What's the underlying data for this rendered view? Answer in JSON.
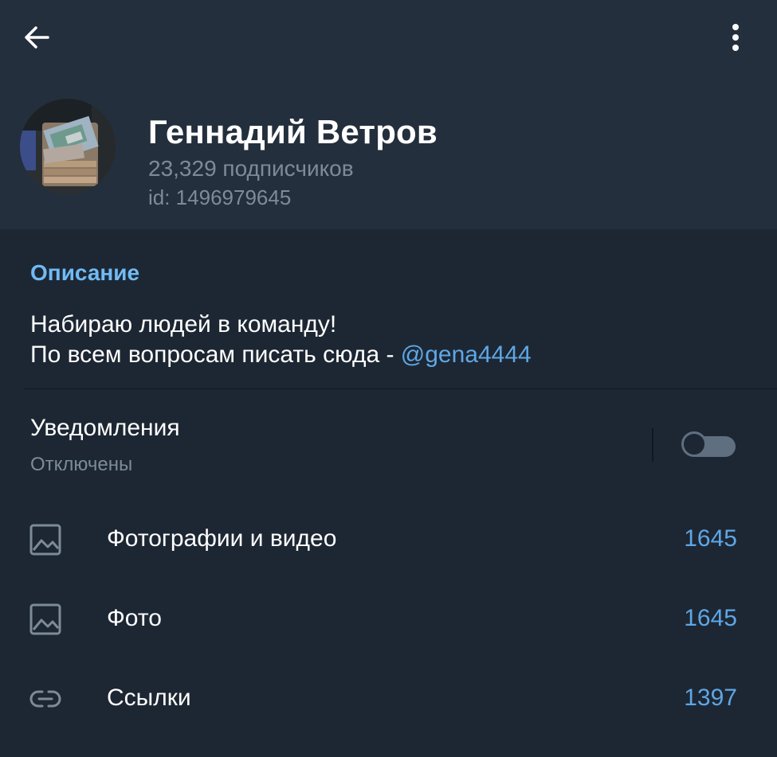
{
  "channel": {
    "name": "Геннадий Ветров",
    "subscribers": "23,329 подписчиков",
    "id_label": "id: 1496979645"
  },
  "description": {
    "title": "Описание",
    "line1": "Набираю людей в команду!",
    "line2_prefix": "По всем вопросам писать сюда - ",
    "link": "@gena4444"
  },
  "notifications": {
    "title": "Уведомления",
    "status": "Отключены",
    "enabled": false
  },
  "media_rows": [
    {
      "label": "Фотографии и видео",
      "count": "1645",
      "icon": "image-icon"
    },
    {
      "label": "Фото",
      "count": "1645",
      "icon": "image-icon"
    },
    {
      "label": "Ссылки",
      "count": "1397",
      "icon": "link-icon"
    }
  ],
  "icons": {
    "back": "back-arrow-icon",
    "menu": "more-vertical-icon"
  },
  "colors": {
    "background": "#1d2733",
    "header": "#242f3d",
    "accent": "#71baf5",
    "link": "#5ea7e6",
    "muted_text": "#7d8b99"
  }
}
